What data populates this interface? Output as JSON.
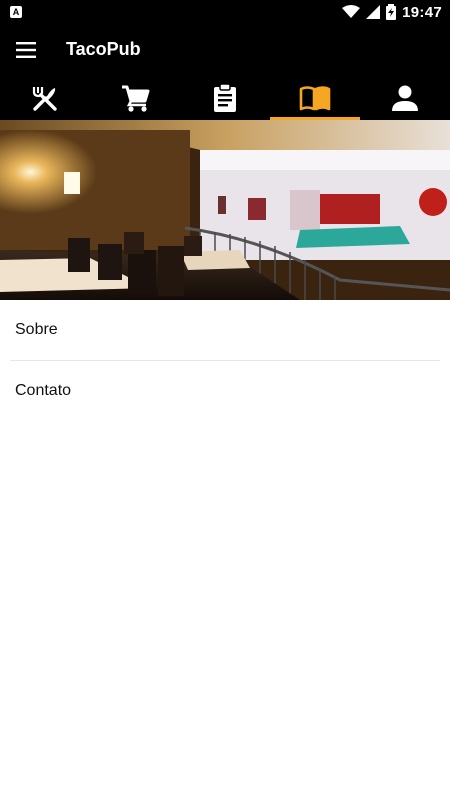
{
  "status_bar": {
    "left_icon_letter": "A",
    "time": "19:47",
    "icons": [
      "wifi-icon",
      "signal-icon",
      "battery-charging-icon"
    ]
  },
  "app_bar": {
    "title": "TacoPub",
    "menu_icon": "menu-icon"
  },
  "tabs": [
    {
      "name": "tab-menu",
      "icon": "utensils-icon",
      "active": false
    },
    {
      "name": "tab-cart",
      "icon": "cart-icon",
      "active": false
    },
    {
      "name": "tab-orders",
      "icon": "clipboard-icon",
      "active": false
    },
    {
      "name": "tab-info",
      "icon": "book-icon",
      "active": true
    },
    {
      "name": "tab-profile",
      "icon": "person-icon",
      "active": false
    }
  ],
  "colors": {
    "accent": "#f5a623",
    "bar_background": "#000000",
    "inactive_icon": "#ffffff"
  },
  "list": {
    "items": [
      {
        "label": "Sobre"
      },
      {
        "label": "Contato"
      }
    ]
  }
}
